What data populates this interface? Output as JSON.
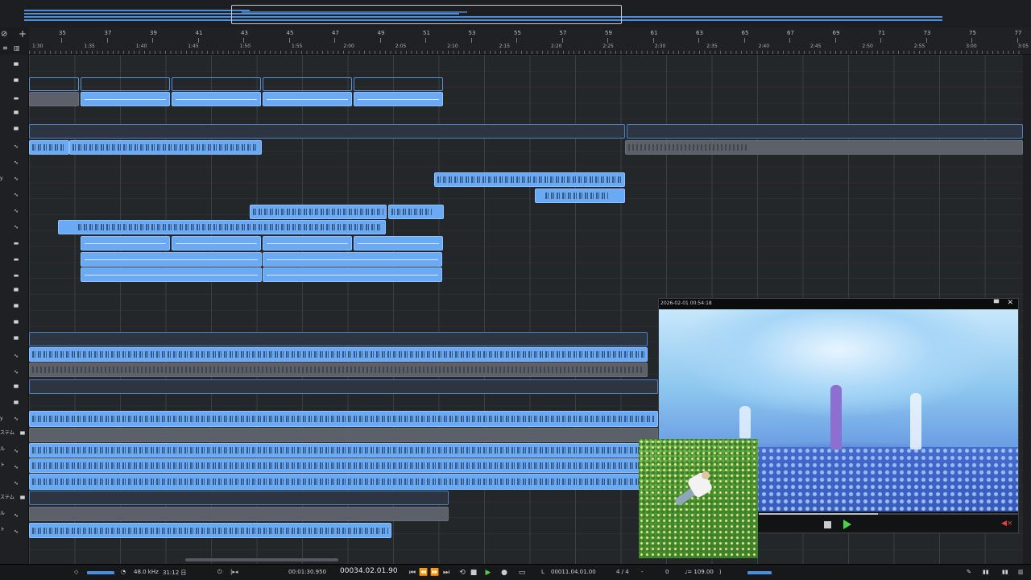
{
  "ruler": {
    "bars": [
      "35",
      "37",
      "39",
      "41",
      "43",
      "45",
      "47",
      "49",
      "51",
      "53",
      "55",
      "57",
      "59",
      "61",
      "63",
      "65",
      "67",
      "69",
      "71",
      "73",
      "75",
      "77"
    ],
    "times": [
      "1:30",
      "1:35",
      "1:40",
      "1:45",
      "1:50",
      "1:55",
      "2:00",
      "2:05",
      "2:10",
      "2:15",
      "2:20",
      "2:25",
      "2:30",
      "2:35",
      "2:40",
      "2:45",
      "2:50",
      "2:55",
      "3:00",
      "3:05"
    ],
    "icon_gear": "⊘",
    "icon_add": "+"
  },
  "tracks": {
    "labels": [
      "y",
      "ステム",
      "ル",
      "ト",
      "ステム",
      "ル",
      "ト"
    ]
  },
  "transport": {
    "sample_rate": "48.0 kHz",
    "record_time": "31:12 日",
    "time_elapsed": "00:01:30.950",
    "position": "00034.02.01.90",
    "loop_position": "00011.04.01.00",
    "time_signature": "4 / 4",
    "dash": "-",
    "zero": "0",
    "tempo": "♩= 109.00",
    "loop_marker": "L"
  },
  "video": {
    "timestamp": "2026-02-01 00:54:18",
    "progress": 0.46
  },
  "colors": {
    "clip": "#6aa9f3",
    "background": "#24272a",
    "play": "#4bd24b",
    "mute": "#e04545"
  }
}
